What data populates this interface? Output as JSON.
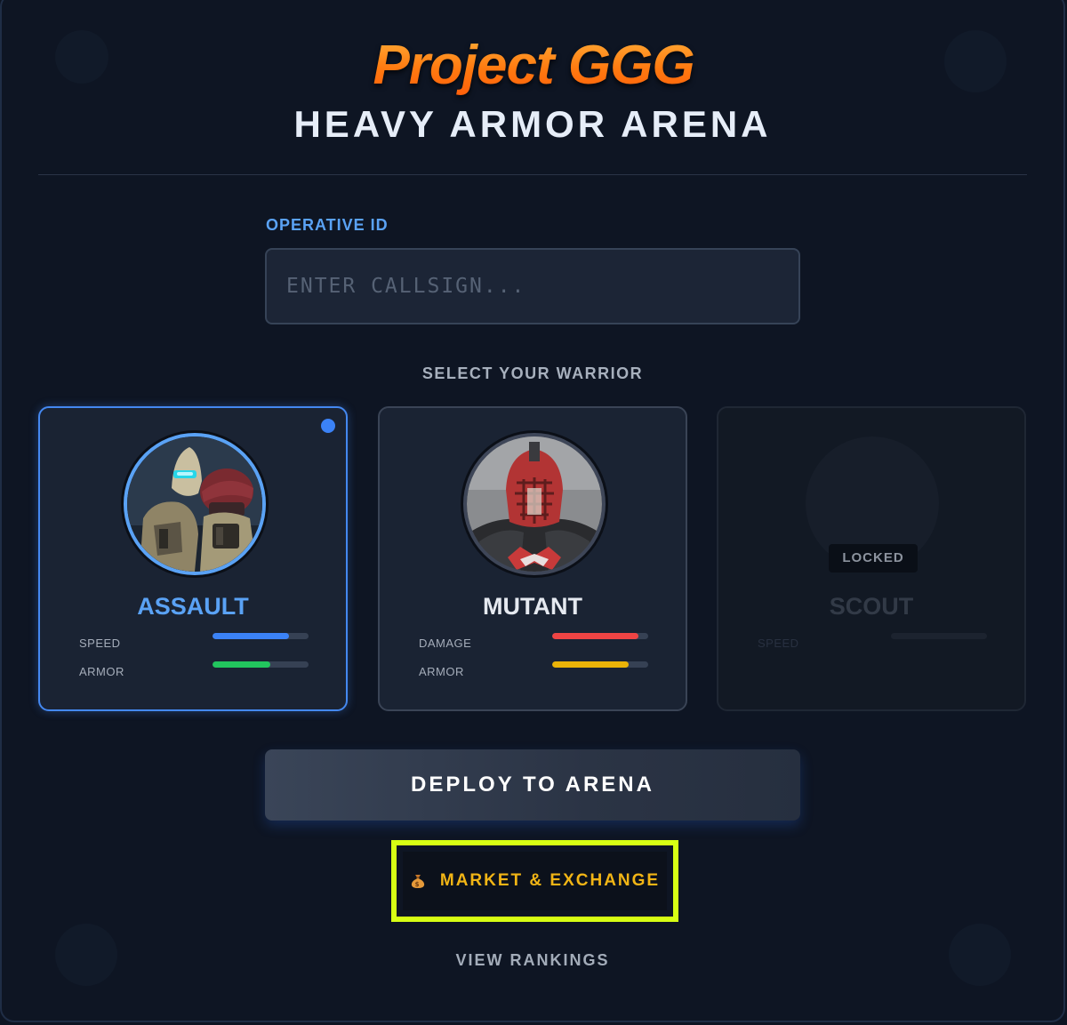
{
  "header": {
    "game_title": "Project GGG",
    "subtitle": "HEAVY ARMOR ARENA"
  },
  "operative": {
    "label": "OPERATIVE ID",
    "placeholder": "ENTER CALLSIGN...",
    "value": ""
  },
  "select_label": "SELECT YOUR WARRIOR",
  "warriors": [
    {
      "name": "ASSAULT",
      "selected": true,
      "locked": false,
      "name_color": "#5aa2f5",
      "stats": [
        {
          "label": "SPEED",
          "value": 0.8,
          "color": "#3b82f6"
        },
        {
          "label": "ARMOR",
          "value": 0.6,
          "color": "#22c55e"
        }
      ]
    },
    {
      "name": "MUTANT",
      "selected": false,
      "locked": false,
      "name_color": "#e5e9f0",
      "stats": [
        {
          "label": "DAMAGE",
          "value": 0.9,
          "color": "#ef4444"
        },
        {
          "label": "ARMOR",
          "value": 0.8,
          "color": "#eab308"
        }
      ]
    },
    {
      "name": "SCOUT",
      "selected": false,
      "locked": true,
      "locked_label": "LOCKED",
      "name_color": "#323a47",
      "stats": [
        {
          "label": "SPEED",
          "value": 0,
          "color": "#2a313d"
        }
      ]
    }
  ],
  "actions": {
    "deploy": "DEPLOY TO ARENA",
    "market": "MARKET & EXCHANGE",
    "market_icon": "money-bag-icon",
    "rankings": "VIEW RANKINGS"
  }
}
